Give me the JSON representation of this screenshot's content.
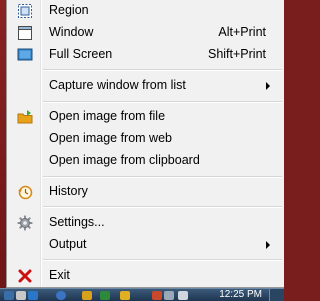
{
  "menu": {
    "items": [
      {
        "label": "Region",
        "icon": "region-icon"
      },
      {
        "label": "Window",
        "shortcut": "Alt+Print",
        "icon": "window-icon"
      },
      {
        "label": "Full Screen",
        "shortcut": "Shift+Print",
        "icon": "fullscreen-icon"
      },
      {
        "label": "Capture window from list",
        "submenu": true
      },
      {
        "label": "Open image from file",
        "icon": "folder-icon"
      },
      {
        "label": "Open image from web"
      },
      {
        "label": "Open image from clipboard"
      },
      {
        "label": "History",
        "icon": "history-icon"
      },
      {
        "label": "Settings...",
        "icon": "gear-icon"
      },
      {
        "label": "Output",
        "submenu": true
      },
      {
        "label": "Exit",
        "icon": "close-icon"
      }
    ]
  },
  "taskbar": {
    "clock": "12:25 PM"
  },
  "colors": {
    "menu_bg": "#f1f1f1",
    "desktop": "#7a1d1d",
    "exit_red": "#cc1111",
    "folder_orange": "#e8a21a",
    "screen_blue": "#2f7fc4"
  }
}
